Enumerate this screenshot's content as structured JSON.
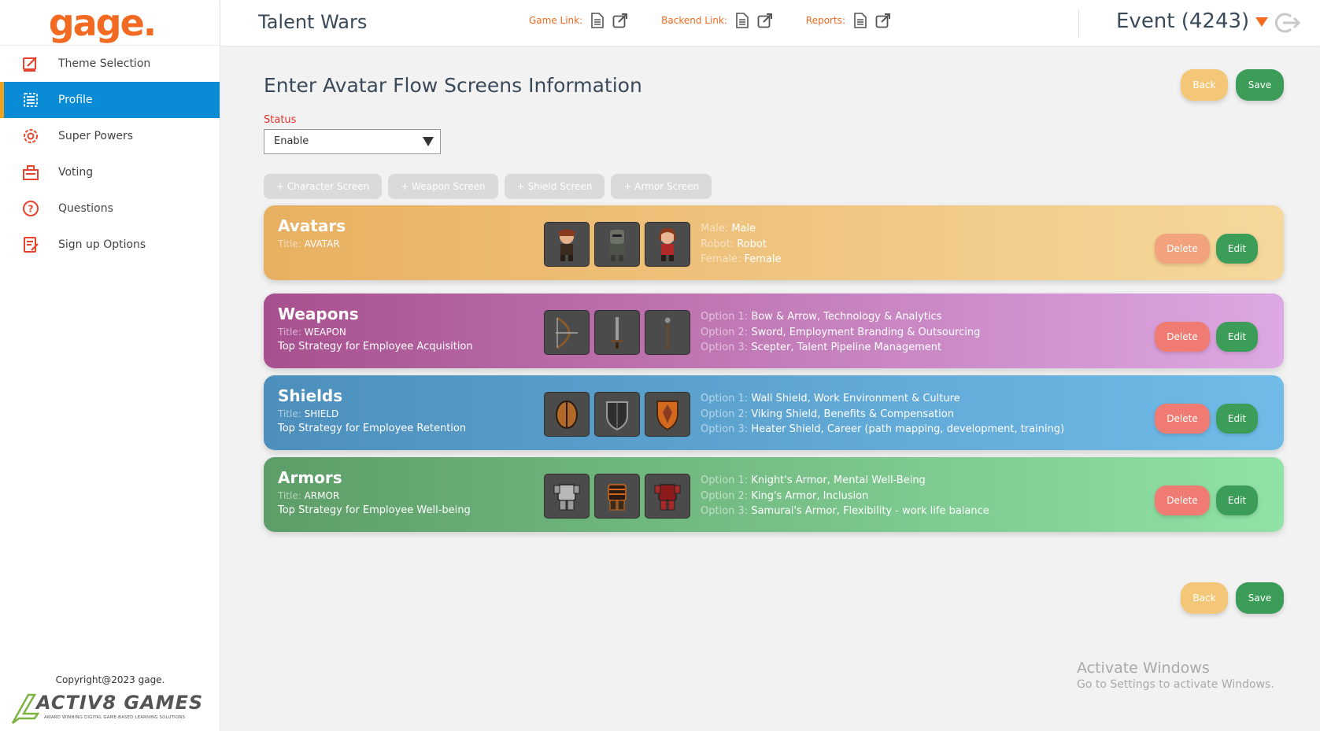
{
  "logo": "gage.",
  "sidebar": {
    "items": [
      {
        "label": "Theme Selection",
        "icon": "theme-icon"
      },
      {
        "label": "Profile",
        "icon": "profile-icon"
      },
      {
        "label": "Super Powers",
        "icon": "superpowers-icon"
      },
      {
        "label": "Voting",
        "icon": "voting-icon"
      },
      {
        "label": "Questions",
        "icon": "question-icon"
      },
      {
        "label": "Sign up Options",
        "icon": "signup-icon"
      }
    ],
    "active_index": 1,
    "copyright": "Copyright@2023 gage.",
    "brand_name": "ACTIV8 GAMES",
    "brand_tagline": "AWARD WINNING DIGITAL GAME-BASED LEARNING SOLUTIONS"
  },
  "header": {
    "title": "Talent Wars",
    "links": [
      {
        "label": "Game Link:"
      },
      {
        "label": "Backend Link:"
      },
      {
        "label": "Reports:"
      }
    ],
    "event": "Event (4243)"
  },
  "main": {
    "title": "Enter Avatar Flow Screens Information",
    "status_label": "Status",
    "status_value": "Enable",
    "tabs": [
      "+ Character Screen",
      "+ Weapon Screen",
      "+ Shield Screen",
      "+ Armor Screen"
    ],
    "back_label": "Back",
    "save_label": "Save",
    "delete_label": "Delete",
    "edit_label": "Edit",
    "cards": {
      "avatars": {
        "title": "Avatars",
        "title_key": "Title:",
        "title_value": "AVATAR",
        "options": [
          {
            "key": "Male:",
            "value": "Male"
          },
          {
            "key": "Robot:",
            "value": "Robot"
          },
          {
            "key": "Female:",
            "value": "Female"
          }
        ]
      },
      "weapons": {
        "title": "Weapons",
        "title_key": "Title:",
        "title_value": "WEAPON",
        "description": "Top Strategy for Employee Acquisition",
        "options": [
          {
            "key": "Option 1:",
            "value": "Bow & Arrow, Technology & Analytics"
          },
          {
            "key": "Option 2:",
            "value": "Sword, Employment Branding & Outsourcing"
          },
          {
            "key": "Option 3:",
            "value": "Scepter, Talent Pipeline Management"
          }
        ]
      },
      "shields": {
        "title": "Shields",
        "title_key": "Title:",
        "title_value": "SHIELD",
        "description": "Top Strategy for Employee Retention",
        "options": [
          {
            "key": "Option 1:",
            "value": "Wall Shield, Work Environment & Culture"
          },
          {
            "key": "Option 2:",
            "value": "Viking Shield, Benefits & Compensation"
          },
          {
            "key": "Option 3:",
            "value": "Heater Shield, Career (path mapping, development, training)"
          }
        ]
      },
      "armors": {
        "title": "Armors",
        "title_key": "Title:",
        "title_value": "ARMOR",
        "description": "Top Strategy for Employee Well-being",
        "options": [
          {
            "key": "Option 1:",
            "value": "Knight's Armor, Mental Well-Being"
          },
          {
            "key": "Option 2:",
            "value": "King's Armor, Inclusion"
          },
          {
            "key": "Option 3:",
            "value": "Samurai's Armor, Flexibility - work life balance"
          }
        ]
      }
    }
  },
  "watermark": {
    "line1": "Activate Windows",
    "line2": "Go to Settings to activate Windows."
  },
  "colors": {
    "accent": "#f26a21",
    "active_nav": "#0a8bd6",
    "save": "#3c9d59",
    "back": "#f3c777"
  }
}
